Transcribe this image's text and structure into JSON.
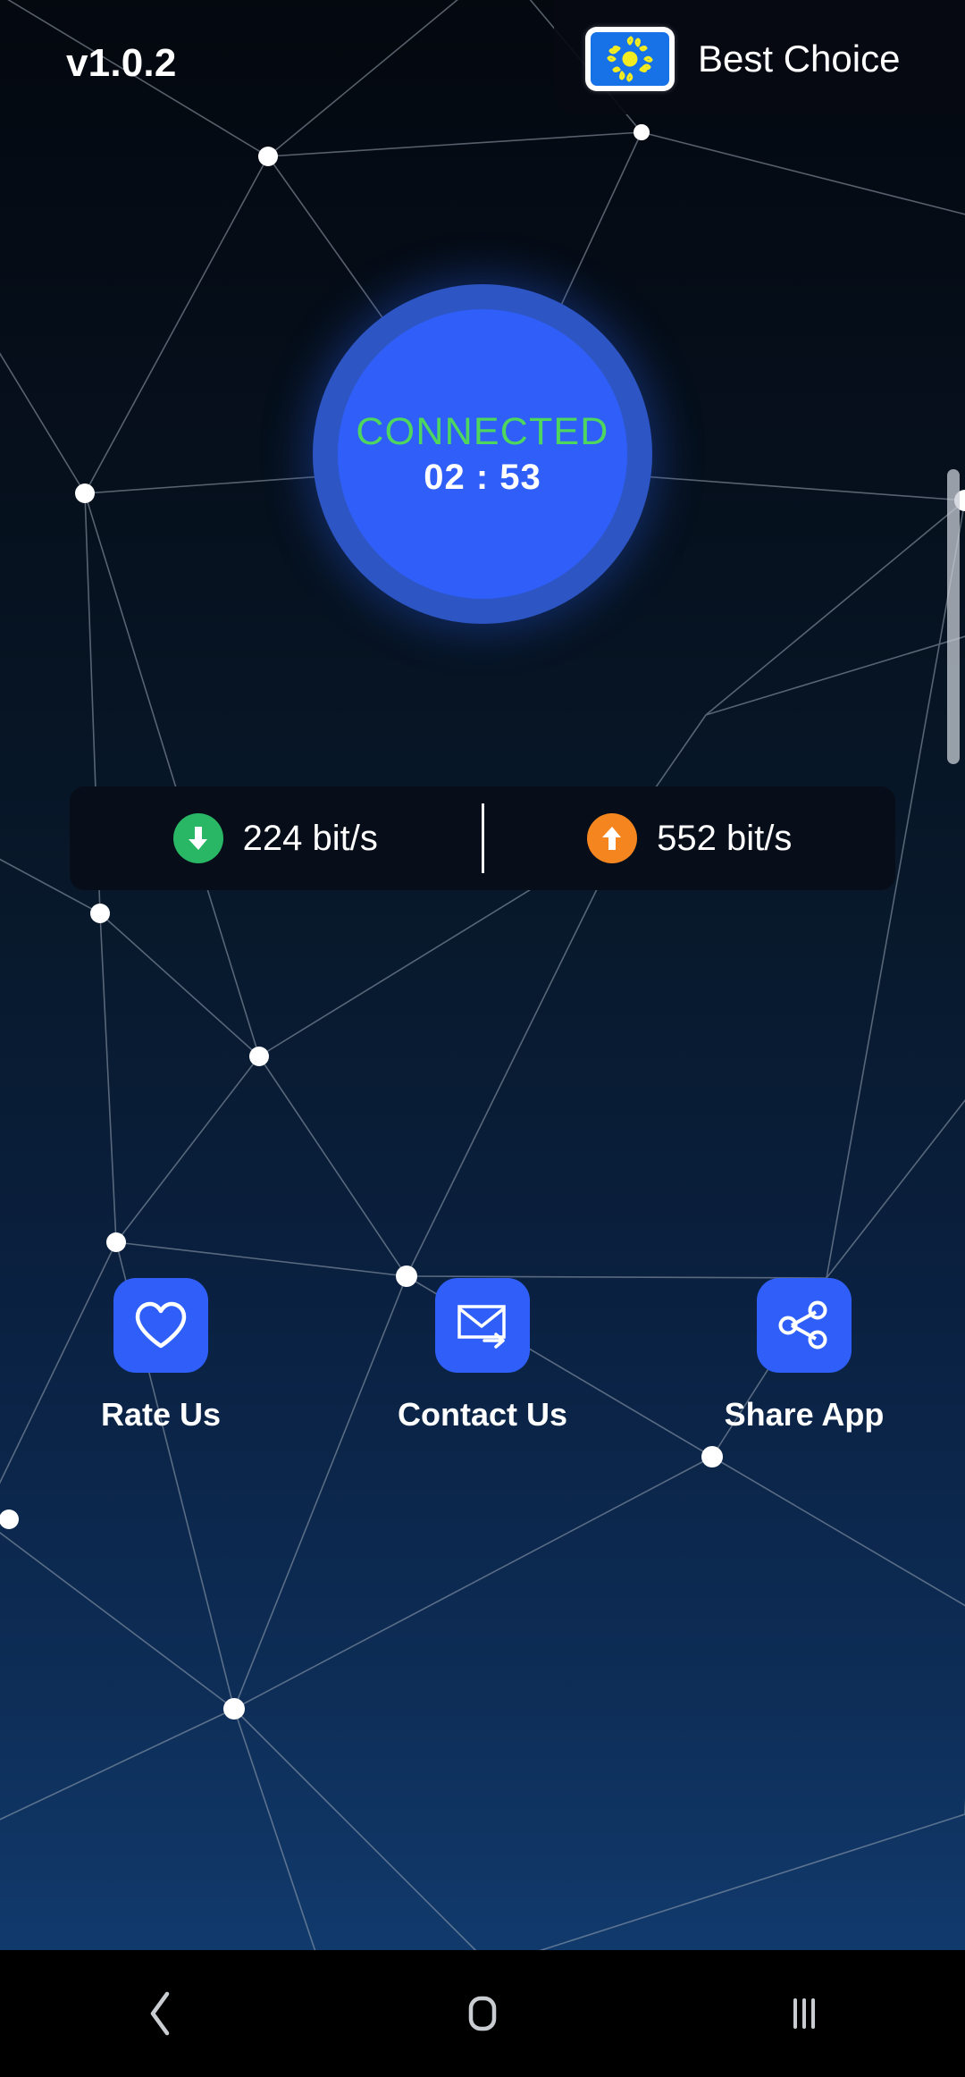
{
  "app": {
    "version_label": "v1.0.2"
  },
  "header": {
    "server_name": "Best Choice",
    "flag_icon": "sun-flag-icon"
  },
  "connect": {
    "status": "CONNECTED",
    "timer": "02 : 53",
    "status_color": "#4ed65f",
    "ring_color": "#2d55c4",
    "core_color": "#2f5ff8"
  },
  "speed": {
    "download": {
      "value": "224 bit/s",
      "icon": "download-arrow-icon",
      "color": "#29b765"
    },
    "upload": {
      "value": "552 bit/s",
      "icon": "upload-arrow-icon",
      "color": "#f5861f"
    }
  },
  "actions": [
    {
      "label": "Rate Us",
      "icon": "heart-icon"
    },
    {
      "label": "Contact Us",
      "icon": "envelope-arrow-icon"
    },
    {
      "label": "Share App",
      "icon": "share-nodes-icon"
    }
  ],
  "navbar": {
    "back": "back-chevron-icon",
    "home": "home-square-icon",
    "recents": "recent-apps-icon"
  }
}
